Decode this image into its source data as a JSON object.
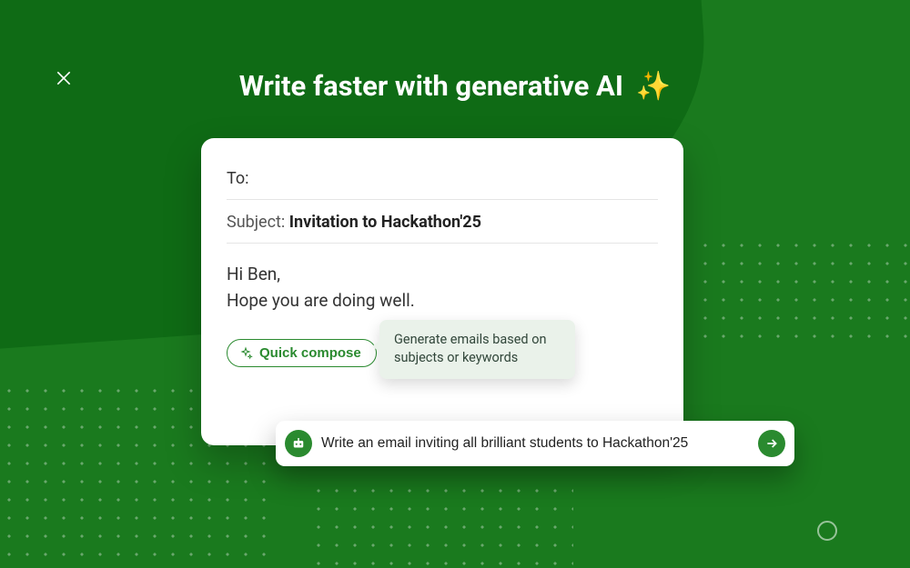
{
  "headline": {
    "text": "Write faster with generative AI",
    "emoji": "✨"
  },
  "compose": {
    "to_label": "To:",
    "subject_label": "Subject:",
    "subject_value": "Invitation to Hackathon'25",
    "body": "Hi Ben,\nHope you are doing well."
  },
  "quick_compose": {
    "label": "Quick compose"
  },
  "tooltip": {
    "text": "Generate emails based on subjects or keywords"
  },
  "prompt": {
    "value": "Write an email inviting all brilliant students to Hackathon'25"
  },
  "colors": {
    "accent": "#2a8a2f",
    "bg": "#1a7a1e"
  }
}
